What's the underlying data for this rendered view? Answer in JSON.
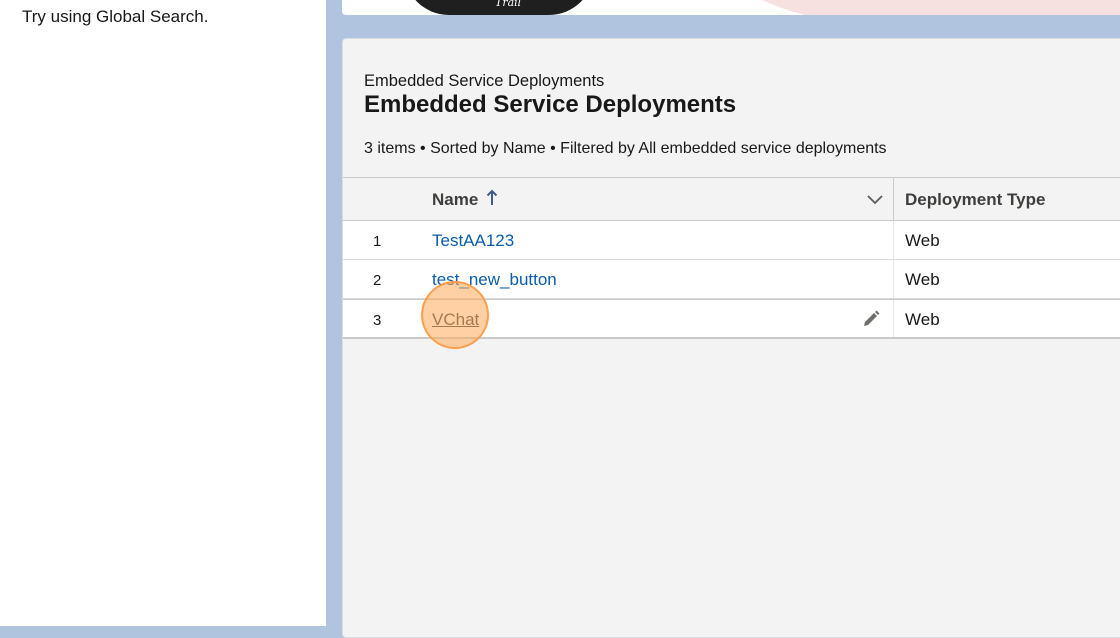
{
  "left_panel": {
    "hint": "Try using Global Search."
  },
  "banner": {
    "mark": "Trail"
  },
  "list_view": {
    "object_label": "Embedded Service Deployments",
    "title": "Embedded Service Deployments",
    "meta": "3 items • Sorted by Name • Filtered by All embedded service deployments",
    "columns": {
      "name": "Name",
      "deployment_type": "Deployment Type"
    },
    "sort_direction": "ascending",
    "rows": [
      {
        "num": "1",
        "name": "TestAA123",
        "type": "Web"
      },
      {
        "num": "2",
        "name": "test_new_button",
        "type": "Web"
      },
      {
        "num": "3",
        "name": "VChat",
        "type": "Web"
      }
    ]
  },
  "colors": {
    "link": "#0b5cab",
    "background": "#b0c4df",
    "click_marker": "#ffaa5a"
  }
}
